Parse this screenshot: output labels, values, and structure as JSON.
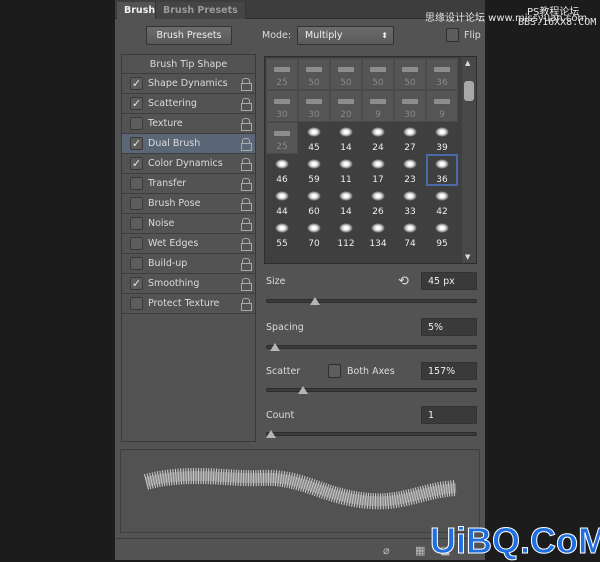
{
  "tabs": [
    {
      "label": "Brush",
      "active": true
    },
    {
      "label": "Brush Presets",
      "active": false
    }
  ],
  "toolbar": {
    "presets_button": "Brush Presets",
    "mode_label": "Mode:",
    "mode_value": "Multiply",
    "flip_label": "Flip",
    "flip_checked": false
  },
  "sidebar": {
    "header": "Brush Tip Shape",
    "items": [
      {
        "label": "Shape Dynamics",
        "checked": true
      },
      {
        "label": "Scattering",
        "checked": true
      },
      {
        "label": "Texture",
        "checked": false
      },
      {
        "label": "Dual Brush",
        "checked": true,
        "selected": true
      },
      {
        "label": "Color Dynamics",
        "checked": true
      },
      {
        "label": "Transfer",
        "checked": false
      },
      {
        "label": "Brush Pose",
        "checked": false
      },
      {
        "label": "Noise",
        "checked": false
      },
      {
        "label": "Wet Edges",
        "checked": false
      },
      {
        "label": "Build-up",
        "checked": false
      },
      {
        "label": "Smoothing",
        "checked": true
      },
      {
        "label": "Protect Texture",
        "checked": false
      }
    ]
  },
  "brushes": [
    "25",
    "50",
    "50",
    "50",
    "50",
    "36",
    "30",
    "30",
    "20",
    "9",
    "30",
    "9",
    "25",
    "45",
    "14",
    "24",
    "27",
    "39",
    "46",
    "59",
    "11",
    "17",
    "23",
    "36",
    "44",
    "60",
    "14",
    "26",
    "33",
    "42",
    "55",
    "70",
    "112",
    "134",
    "74",
    "95"
  ],
  "selected_brush_index": 23,
  "dimmed_count": 13,
  "settings": {
    "size": {
      "label": "Size",
      "value": "45 px",
      "slider": 0.22
    },
    "spacing": {
      "label": "Spacing",
      "value": "5%",
      "slider": 0.02
    },
    "scatter": {
      "label": "Scatter",
      "both_axes_label": "Both Axes",
      "both_axes_checked": false,
      "value": "157%",
      "slider": 0.16
    },
    "count": {
      "label": "Count",
      "value": "1",
      "slider": 0.0
    }
  },
  "watermarks": {
    "top1": "思缘设计论坛 www.missyuan.com",
    "top2": "PS教程论坛",
    "top3": "BBS.16XX8.COM",
    "bottom": "UiBQ.CoM"
  },
  "colors": {
    "panel": "#535353",
    "selection": "#5b6677",
    "selected_brush_border": "#4a6aa8"
  }
}
